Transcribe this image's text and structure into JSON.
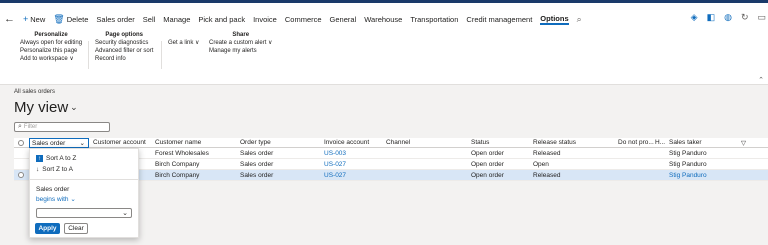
{
  "nav": {
    "back_icon": "back-arrow-icon",
    "new_label": "New",
    "delete_label": "Delete",
    "tabs": [
      "Sales order",
      "Sell",
      "Manage",
      "Pick and pack",
      "Invoice",
      "Commerce",
      "General",
      "Warehouse",
      "Transportation",
      "Credit management",
      "Options"
    ],
    "selected_tab": "Options"
  },
  "groups": {
    "personalize": {
      "header": "Personalize",
      "items": [
        "Always open for editing",
        "Personalize this page",
        "Add to workspace ∨"
      ]
    },
    "page_options": {
      "header": "Page options",
      "items": [
        "Security diagnostics",
        "Advanced filter or sort",
        "Record info"
      ]
    },
    "get_link": "Get a link ∨",
    "share": {
      "header": "Share",
      "items": [
        "Create a custom alert ∨",
        "Manage my alerts"
      ]
    }
  },
  "breadcrumb": "All sales orders",
  "view_title": "My view",
  "filter_placeholder": "Filter",
  "grid": {
    "columns": [
      "Sales order",
      "Customer account",
      "Customer name",
      "Order type",
      "Invoice account",
      "Channel",
      "Status",
      "Release status",
      "Do not pro...",
      "H...",
      "Sales taker"
    ],
    "rows": [
      {
        "customer_name": "Forest Wholesales",
        "order_type": "Sales order",
        "invoice_account": "US-003",
        "status": "Open order",
        "release_status": "Released",
        "sales_taker": "Stig Panduro"
      },
      {
        "customer_name": "Birch Company",
        "order_type": "Sales order",
        "invoice_account": "US-027",
        "status": "Open order",
        "release_status": "Open",
        "sales_taker": "Stig Panduro"
      },
      {
        "customer_name": "Birch Company",
        "order_type": "Sales order",
        "invoice_account": "US-027",
        "status": "Open order",
        "release_status": "Released",
        "sales_taker": "Stig Panduro"
      }
    ]
  },
  "popup": {
    "sort_asc": "Sort A to Z",
    "sort_desc": "Sort Z to A",
    "field_label": "Sales order",
    "operator": "begins with",
    "apply_label": "Apply",
    "clear_label": "Clear"
  },
  "colors": {
    "accent": "#0f6cbd",
    "selected_row": "#d8e6f6"
  }
}
